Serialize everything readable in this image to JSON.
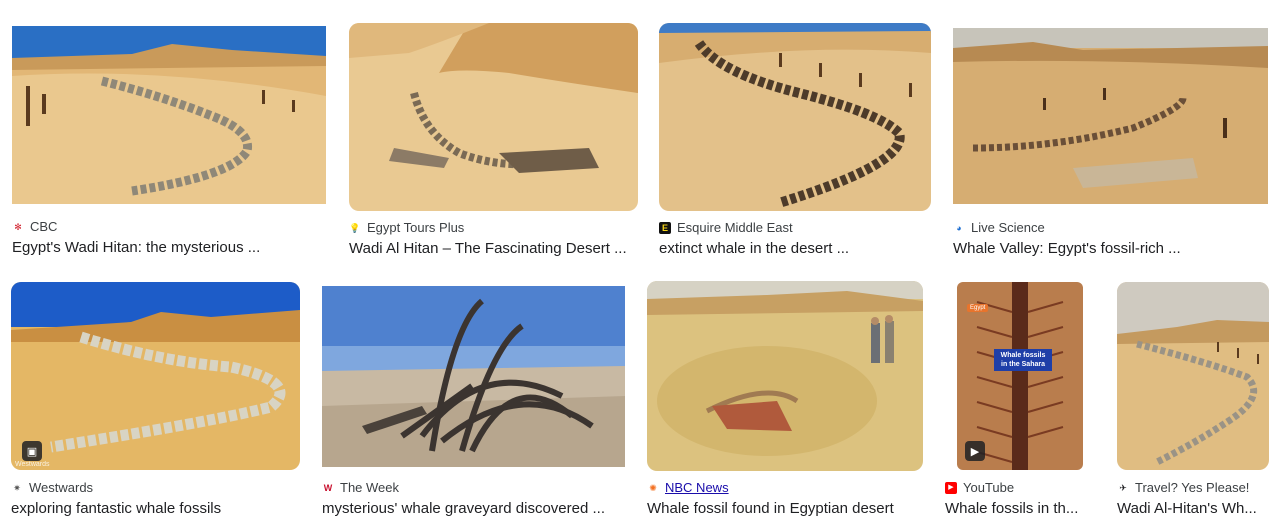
{
  "results": [
    {
      "source": "CBC",
      "favicon": "cbc-gem-icon",
      "title": "Egypt's Wadi Hitan: the mysterious ..."
    },
    {
      "source": "Egypt Tours Plus",
      "favicon": "lightbulb-icon",
      "title": "Wadi Al Hitan – The Fascinating Desert ..."
    },
    {
      "source": "Esquire Middle East",
      "favicon": "esquire-e-icon",
      "title": "extinct whale in the desert ..."
    },
    {
      "source": "Live Science",
      "favicon": "live-science-icon",
      "title": "Whale Valley: Egypt's fossil-rich ..."
    },
    {
      "source": "Westwards",
      "favicon": "westwards-icon",
      "title": "exploring fantastic whale fossils",
      "watermark": "Westwards"
    },
    {
      "source": "The Week",
      "favicon": "the-week-w-icon",
      "title": "mysterious' whale graveyard discovered ..."
    },
    {
      "source": "NBC News",
      "favicon": "nbc-peacock-icon",
      "title": "Whale fossil found in Egyptian desert"
    },
    {
      "source": "YouTube",
      "favicon": "youtube-icon",
      "title": "Whale fossils in th...",
      "overlay_text": "Whale fossils in the Sahara",
      "overlay_tag": "Egypt"
    },
    {
      "source": "Travel? Yes Please!",
      "favicon": "airplane-icon",
      "title": "Wadi Al-Hitan's Wh..."
    }
  ],
  "badges": {
    "image": "image-badge-icon",
    "video": "play-badge-icon"
  }
}
